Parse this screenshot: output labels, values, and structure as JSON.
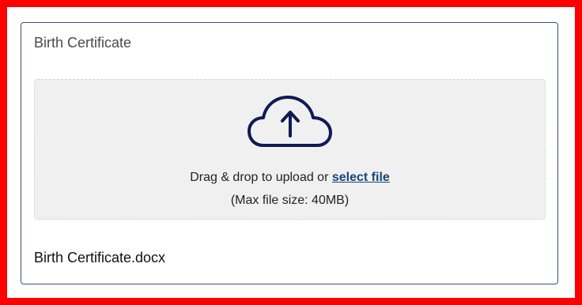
{
  "upload_card": {
    "title": "Birth Certificate",
    "dropzone": {
      "icon": "cloud-upload-icon",
      "instruction_prefix": "Drag & drop to upload or ",
      "select_file_label": "select file",
      "max_size_text": "(Max file size: 40MB)"
    },
    "uploaded_file_name": "Birth Certificate.docx"
  },
  "colors": {
    "highlight_border": "#ff0000",
    "card_border": "#3d4f7c",
    "icon": "#0f1a55",
    "link": "#17477b",
    "dropzone_bg": "#f0f0f0"
  }
}
